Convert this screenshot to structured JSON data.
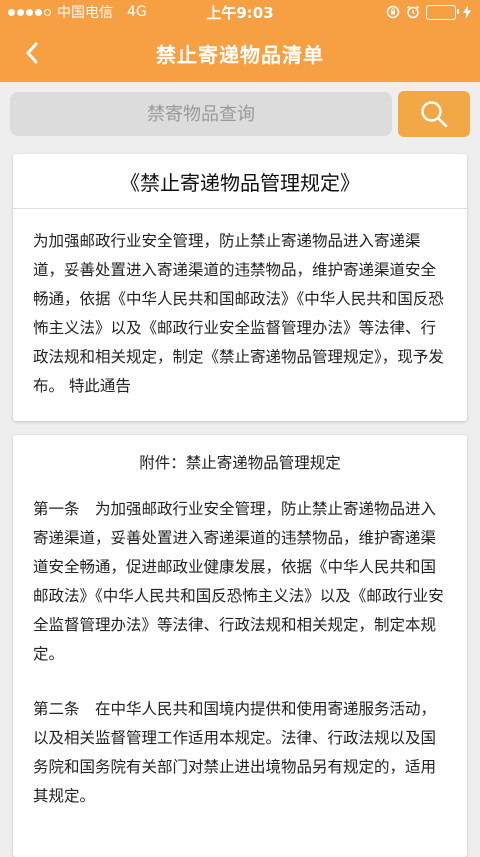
{
  "status_bar": {
    "carrier": "中国电信",
    "network": "4G",
    "time": "上午9:03"
  },
  "nav": {
    "title": "禁止寄递物品清单"
  },
  "search": {
    "placeholder": "禁寄物品查询"
  },
  "card1": {
    "title": "《禁止寄递物品管理规定》",
    "body": "为加强邮政行业安全管理，防止禁止寄递物品进入寄递渠道，妥善处置进入寄递渠道的违禁物品，维护寄递渠道安全畅通，依据《中华人民共和国邮政法》《中华人民共和国反恐怖主义法》以及《邮政行业安全监督管理办法》等法律、行政法规和相关规定，制定《禁止寄递物品管理规定》，现予发布。 特此通告"
  },
  "card2": {
    "title": "附件：禁止寄递物品管理规定",
    "articles": [
      "第一条　为加强邮政行业安全管理，防止禁止寄递物品进入寄递渠道，妥善处置进入寄递渠道的违禁物品，维护寄递渠道安全畅通，促进邮政业健康发展，依据《中华人民共和国邮政法》《中华人民共和国反恐怖主义法》以及《邮政行业安全监督管理办法》等法律、行政法规和相关规定，制定本规定。",
      "第二条　在中华人民共和国境内提供和使用寄递服务活动，以及相关监督管理工作适用本规定。法律、行政法规以及国务院和国务院有关部门对禁止进出境物品另有规定的，适用其规定。"
    ]
  },
  "colors": {
    "header": "#f7a043",
    "search_button": "#f2a844"
  }
}
